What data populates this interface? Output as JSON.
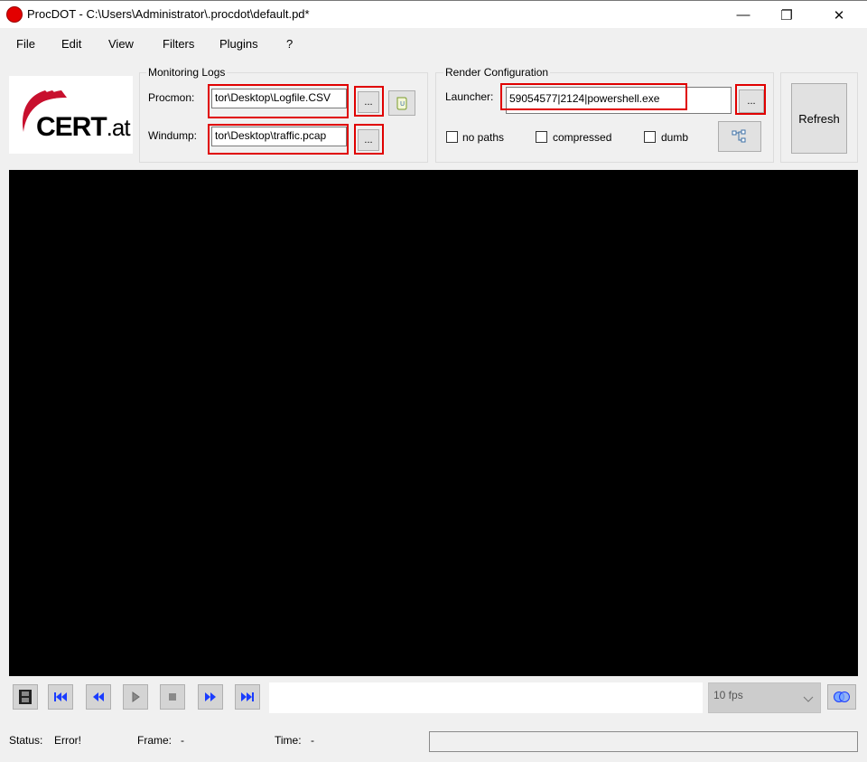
{
  "window": {
    "title": "ProcDOT - C:\\Users\\Administrator\\.procdot\\default.pd*",
    "controls": {
      "minimize": "—",
      "restore": "❐",
      "close": "✕"
    }
  },
  "menu": [
    "File",
    "Edit",
    "View",
    "Filters",
    "Plugins",
    "?"
  ],
  "logo": {
    "text_main": "CERT",
    "text_suffix": ".at"
  },
  "monitoring_logs": {
    "title": "Monitoring Logs",
    "procmon_label": "Procmon:",
    "procmon_value": "tor\\Desktop\\Logfile.CSV",
    "windump_label": "Windump:",
    "windump_value": "tor\\Desktop\\traffic.pcap",
    "browse_label": "..."
  },
  "render_config": {
    "title": "Render Configuration",
    "launcher_label": "Launcher:",
    "launcher_value": "59054577|2124|powershell.exe",
    "browse_label": "...",
    "no_paths_label": "no paths",
    "compressed_label": "compressed",
    "dumb_label": "dumb"
  },
  "refresh_label": "Refresh",
  "playback": {
    "fps_value": "10 fps"
  },
  "status": {
    "status_label": "Status:",
    "status_value": "Error!",
    "frame_label": "Frame:",
    "frame_value": "-",
    "time_label": "Time:",
    "time_value": "-"
  },
  "colors": {
    "highlight": "#e00000",
    "media_icon": "#1a3cff",
    "logo_red": "#c8102e"
  }
}
